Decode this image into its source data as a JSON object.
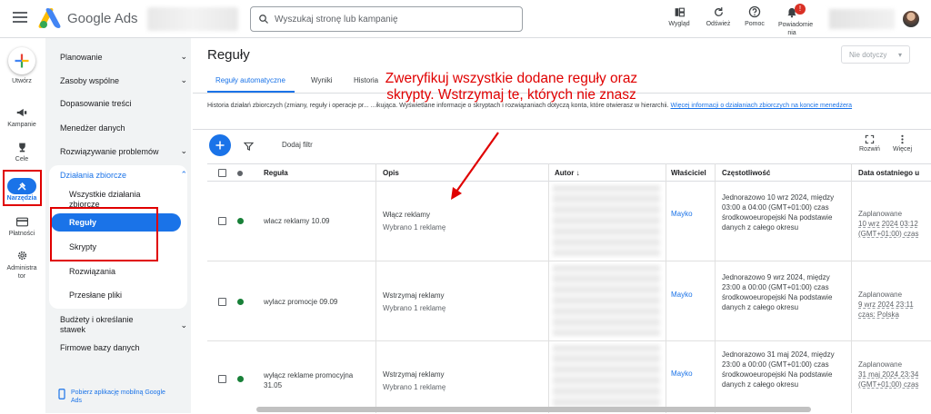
{
  "app": {
    "name": "Google Ads"
  },
  "search": {
    "placeholder": "Wyszukaj stronę lub kampanię"
  },
  "toolbar_top": [
    {
      "label": "Wygląd",
      "icon": "appearance-icon"
    },
    {
      "label": "Odśwież",
      "icon": "refresh-icon"
    },
    {
      "label": "Pomoc",
      "icon": "help-icon"
    },
    {
      "label": "Powiadomie nia",
      "icon": "bell-icon",
      "badge": "!"
    }
  ],
  "rail": {
    "create": "Utwórz",
    "items": [
      {
        "label": "Kampanie",
        "icon": "campaigns-icon"
      },
      {
        "label": "Cele",
        "icon": "trophy-icon"
      },
      {
        "label": "Narzędzia",
        "icon": "tools-icon",
        "active": true
      },
      {
        "label": "Płatności",
        "icon": "card-icon"
      },
      {
        "label": "Administra tor",
        "icon": "admin-gear-icon"
      }
    ]
  },
  "sidenav": {
    "items": [
      "Planowanie",
      "Zasoby wspólne",
      "Dopasowanie treści",
      "Menedżer danych",
      "Rozwiązywanie problemów"
    ],
    "group": "Działania zbiorcze",
    "sub": [
      "Wszystkie działania zbiorcze",
      "Reguły",
      "Skrypty",
      "Rozwiązania",
      "Przesłane pliki"
    ],
    "after": [
      "Budżety i określanie stawek",
      "Firmowe bazy danych"
    ],
    "mobile": "Pobierz aplikację mobilną Google Ads"
  },
  "main": {
    "title": "Reguły",
    "segment": "Nie dotyczy",
    "tabs": [
      "Reguły automatyczne",
      "Wyniki",
      "Historia"
    ],
    "info_text": "Historia działań zbiorczych (zmiany, reguły i operacje pr... ...ikująca. Wyświetlane informacje o skryptach i rozwiązaniach dotyczą konta, które otwierasz w hierarchii.",
    "info_link": "Więcej informacji o działaniach zbiorczych na koncie menedżera",
    "add_filter": "Dodaj filtr",
    "expand": "Rozwiń",
    "more": "Więcej"
  },
  "table": {
    "columns": [
      "Reguła",
      "Opis",
      "Autor",
      "Właściciel",
      "Częstotliwość",
      "Data ostatniego u"
    ],
    "rows": [
      {
        "rule": "wlacz reklamy 10.09",
        "desc": "Włącz reklamy",
        "desc2": "Wybrano 1 reklamę",
        "owner": "Mayko",
        "freq": "Jednorazowo 10 wrz 2024, między 03:00 a 04:00 (GMT+01:00) czas środkowoeuropejski Na podstawie danych z całego okresu",
        "last1": "Zaplanowane",
        "last2": "10 wrz 2024 03:12",
        "last3": "(GMT+01:00) czas"
      },
      {
        "rule": "wylacz promocje 09.09",
        "desc": "Wstrzymaj reklamy",
        "desc2": "Wybrano 1 reklamę",
        "owner": "Mayko",
        "freq": "Jednorazowo 9 wrz 2024, między 23:00 a 00:00 (GMT+01:00) czas środkowoeuropejski Na podstawie danych z całego okresu",
        "last1": "Zaplanowane",
        "last2": "9 wrz 2024 23:11",
        "last3": "czas: Polska"
      },
      {
        "rule": "wyłącz reklame promocyjna 31.05",
        "desc": "Wstrzymaj reklamy",
        "desc2": "Wybrano 1 reklamę",
        "owner": "Mayko",
        "freq": "Jednorazowo 31 maj 2024, między 23:00 a 00:00 (GMT+01:00) czas środkowoeuropejski Na podstawie danych z całego okresu",
        "last1": "Zaplanowane",
        "last2": "31 maj 2024 23:34",
        "last3": "(GMT+01:00) czas"
      }
    ]
  },
  "annotation": "Zweryfikuj wszystkie dodane reguły oraz skrypty. Wstrzymaj te, których nie znasz",
  "colors": {
    "accent": "#1a73e8",
    "annotation": "#e00000",
    "status": "#188038"
  }
}
